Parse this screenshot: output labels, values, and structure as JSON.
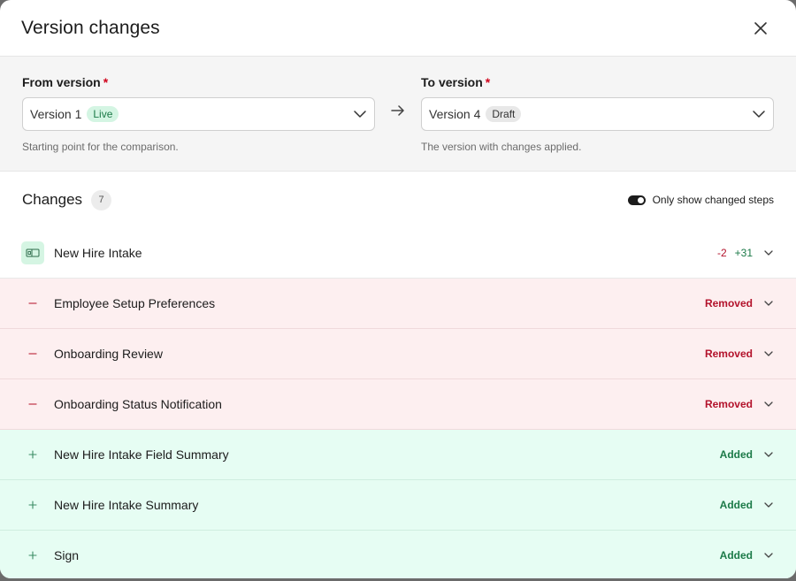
{
  "dialog": {
    "title": "Version changes"
  },
  "from": {
    "label": "From version",
    "required": "*",
    "value": "Version 1",
    "badge": "Live",
    "help": "Starting point for the comparison."
  },
  "to": {
    "label": "To version",
    "required": "*",
    "value": "Version 4",
    "badge": "Draft",
    "help": "The version with changes applied."
  },
  "changes": {
    "title": "Changes",
    "count": "7",
    "toggle_label": "Only show changed steps",
    "toggle_on": true
  },
  "rows": [
    {
      "label": "New Hire Intake",
      "type": "modified",
      "minus": "-2",
      "plus": "+31",
      "icon": "form-icon"
    },
    {
      "label": "Employee Setup Preferences",
      "type": "removed",
      "status": "Removed",
      "icon": "minus-icon"
    },
    {
      "label": "Onboarding Review",
      "type": "removed",
      "status": "Removed",
      "icon": "minus-icon"
    },
    {
      "label": "Onboarding Status Notification",
      "type": "removed",
      "status": "Removed",
      "icon": "minus-icon"
    },
    {
      "label": "New Hire Intake Field Summary",
      "type": "added",
      "status": "Added",
      "icon": "plus-icon"
    },
    {
      "label": "New Hire Intake Summary",
      "type": "added",
      "status": "Added",
      "icon": "plus-icon"
    },
    {
      "label": "Sign",
      "type": "added",
      "status": "Added",
      "icon": "plus-icon"
    }
  ],
  "colors": {
    "removed_bg": "#fdeff0",
    "added_bg": "#e6fdf3",
    "removed_text": "#b3122b",
    "added_text": "#1c7a48"
  }
}
